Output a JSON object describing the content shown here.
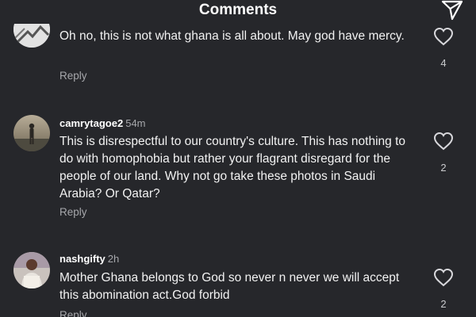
{
  "header": {
    "title": "Comments",
    "share_icon": "send-icon"
  },
  "comments": [
    {
      "username": "",
      "timestamp": "",
      "text": "Oh no, this is not what ghana is all about. May god have mercy.",
      "reply_label": "Reply",
      "likes": "4"
    },
    {
      "username": "camrytagoe2",
      "timestamp": "54m",
      "text": "This is disrespectful to our country's culture. This has nothing to do with homophobia but rather your flagrant disregard for the people of our land. Why not go take these photos in Saudi Arabia? Or Qatar?",
      "reply_label": "Reply",
      "likes": "2"
    },
    {
      "username": "nashgifty",
      "timestamp": "2h",
      "text": "Mother Ghana belongs to God so never n never we will accept this abomination act.God forbid",
      "reply_label": "Reply",
      "likes": "2"
    }
  ],
  "colors": {
    "background": "#26272b",
    "primary_text": "#f2f2f2",
    "secondary_text": "#a6a7ab"
  }
}
